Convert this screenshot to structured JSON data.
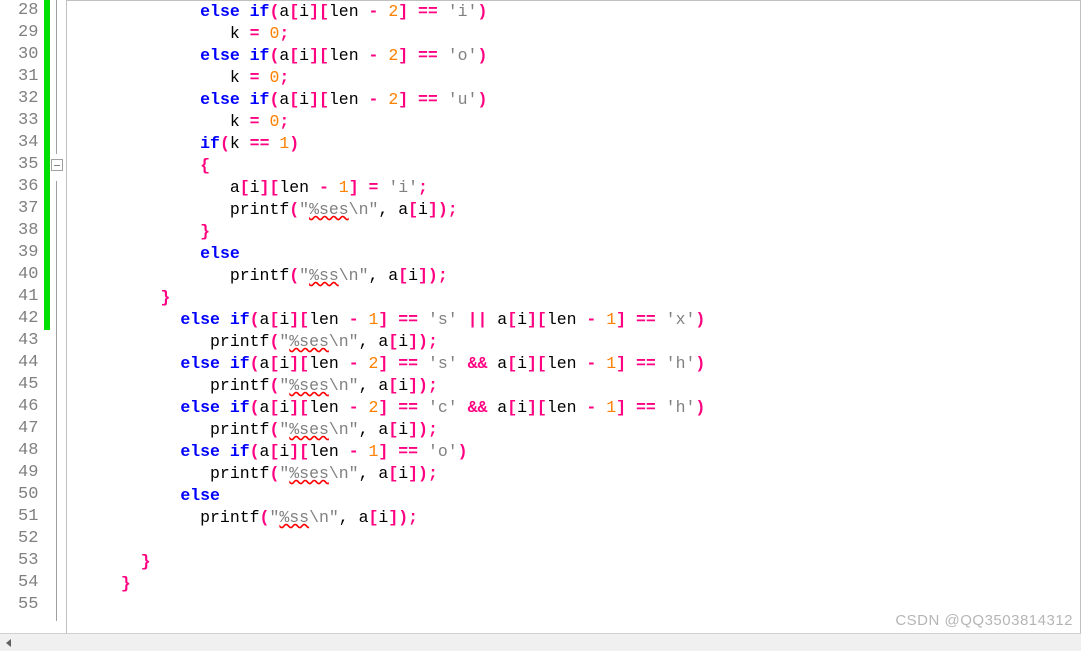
{
  "gutter": {
    "start": 28,
    "end": 55,
    "changed_through": 42
  },
  "fold": {
    "box_at": 35
  },
  "code_lines": [
    {
      "indent": 13,
      "tokens": [
        {
          "t": "else if",
          "c": "kw"
        },
        {
          "t": "(",
          "c": "paren"
        },
        {
          "t": "a"
        },
        {
          "t": "[",
          "c": "paren"
        },
        {
          "t": "i"
        },
        {
          "t": "][",
          "c": "paren"
        },
        {
          "t": "len "
        },
        {
          "t": "-",
          "c": "op"
        },
        {
          "t": " "
        },
        {
          "t": "2",
          "c": "num"
        },
        {
          "t": "]",
          "c": "paren"
        },
        {
          "t": " "
        },
        {
          "t": "==",
          "c": "op"
        },
        {
          "t": " "
        },
        {
          "t": "'i'",
          "c": "str"
        },
        {
          "t": ")",
          "c": "paren"
        }
      ]
    },
    {
      "indent": 16,
      "tokens": [
        {
          "t": "k "
        },
        {
          "t": "=",
          "c": "op"
        },
        {
          "t": " "
        },
        {
          "t": "0",
          "c": "num"
        },
        {
          "t": ";",
          "c": "op"
        }
      ]
    },
    {
      "indent": 13,
      "tokens": [
        {
          "t": "else if",
          "c": "kw"
        },
        {
          "t": "(",
          "c": "paren"
        },
        {
          "t": "a"
        },
        {
          "t": "[",
          "c": "paren"
        },
        {
          "t": "i"
        },
        {
          "t": "][",
          "c": "paren"
        },
        {
          "t": "len "
        },
        {
          "t": "-",
          "c": "op"
        },
        {
          "t": " "
        },
        {
          "t": "2",
          "c": "num"
        },
        {
          "t": "]",
          "c": "paren"
        },
        {
          "t": " "
        },
        {
          "t": "==",
          "c": "op"
        },
        {
          "t": " "
        },
        {
          "t": "'o'",
          "c": "str"
        },
        {
          "t": ")",
          "c": "paren"
        }
      ]
    },
    {
      "indent": 16,
      "tokens": [
        {
          "t": "k "
        },
        {
          "t": "=",
          "c": "op"
        },
        {
          "t": " "
        },
        {
          "t": "0",
          "c": "num"
        },
        {
          "t": ";",
          "c": "op"
        }
      ]
    },
    {
      "indent": 13,
      "tokens": [
        {
          "t": "else if",
          "c": "kw"
        },
        {
          "t": "(",
          "c": "paren"
        },
        {
          "t": "a"
        },
        {
          "t": "[",
          "c": "paren"
        },
        {
          "t": "i"
        },
        {
          "t": "][",
          "c": "paren"
        },
        {
          "t": "len "
        },
        {
          "t": "-",
          "c": "op"
        },
        {
          "t": " "
        },
        {
          "t": "2",
          "c": "num"
        },
        {
          "t": "]",
          "c": "paren"
        },
        {
          "t": " "
        },
        {
          "t": "==",
          "c": "op"
        },
        {
          "t": " "
        },
        {
          "t": "'u'",
          "c": "str"
        },
        {
          "t": ")",
          "c": "paren"
        }
      ]
    },
    {
      "indent": 16,
      "tokens": [
        {
          "t": "k "
        },
        {
          "t": "=",
          "c": "op"
        },
        {
          "t": " "
        },
        {
          "t": "0",
          "c": "num"
        },
        {
          "t": ";",
          "c": "op"
        }
      ]
    },
    {
      "indent": 13,
      "tokens": [
        {
          "t": "if",
          "c": "kw"
        },
        {
          "t": "(",
          "c": "paren"
        },
        {
          "t": "k "
        },
        {
          "t": "==",
          "c": "op"
        },
        {
          "t": " "
        },
        {
          "t": "1",
          "c": "num"
        },
        {
          "t": ")",
          "c": "paren"
        }
      ]
    },
    {
      "indent": 13,
      "tokens": [
        {
          "t": "{",
          "c": "op"
        }
      ]
    },
    {
      "indent": 16,
      "tokens": [
        {
          "t": "a"
        },
        {
          "t": "[",
          "c": "paren"
        },
        {
          "t": "i"
        },
        {
          "t": "][",
          "c": "paren"
        },
        {
          "t": "len "
        },
        {
          "t": "-",
          "c": "op"
        },
        {
          "t": " "
        },
        {
          "t": "1",
          "c": "num"
        },
        {
          "t": "]",
          "c": "paren"
        },
        {
          "t": " "
        },
        {
          "t": "=",
          "c": "op"
        },
        {
          "t": " "
        },
        {
          "t": "'i'",
          "c": "str"
        },
        {
          "t": ";",
          "c": "op"
        }
      ]
    },
    {
      "indent": 16,
      "tokens": [
        {
          "t": "printf"
        },
        {
          "t": "(",
          "c": "paren"
        },
        {
          "t": "\"",
          "c": "str"
        },
        {
          "t": "%ses",
          "c": "fmt"
        },
        {
          "t": "\\n\"",
          "c": "str"
        },
        {
          "t": ","
        },
        {
          "t": " a"
        },
        {
          "t": "[",
          "c": "paren"
        },
        {
          "t": "i"
        },
        {
          "t": "])",
          "c": "paren"
        },
        {
          "t": ";",
          "c": "op"
        }
      ]
    },
    {
      "indent": 13,
      "tokens": [
        {
          "t": "}",
          "c": "op"
        }
      ]
    },
    {
      "indent": 13,
      "tokens": [
        {
          "t": "else",
          "c": "kw"
        }
      ]
    },
    {
      "indent": 16,
      "tokens": [
        {
          "t": "printf"
        },
        {
          "t": "(",
          "c": "paren"
        },
        {
          "t": "\"",
          "c": "str"
        },
        {
          "t": "%ss",
          "c": "fmt"
        },
        {
          "t": "\\n\"",
          "c": "str"
        },
        {
          "t": ","
        },
        {
          "t": " a"
        },
        {
          "t": "[",
          "c": "paren"
        },
        {
          "t": "i"
        },
        {
          "t": "])",
          "c": "paren"
        },
        {
          "t": ";",
          "c": "op"
        }
      ]
    },
    {
      "indent": 9,
      "tokens": [
        {
          "t": "}",
          "c": "op"
        }
      ]
    },
    {
      "indent": 11,
      "tokens": [
        {
          "t": "else if",
          "c": "kw"
        },
        {
          "t": "(",
          "c": "paren"
        },
        {
          "t": "a"
        },
        {
          "t": "[",
          "c": "paren"
        },
        {
          "t": "i"
        },
        {
          "t": "][",
          "c": "paren"
        },
        {
          "t": "len "
        },
        {
          "t": "-",
          "c": "op"
        },
        {
          "t": " "
        },
        {
          "t": "1",
          "c": "num"
        },
        {
          "t": "]",
          "c": "paren"
        },
        {
          "t": " "
        },
        {
          "t": "==",
          "c": "op"
        },
        {
          "t": " "
        },
        {
          "t": "'s'",
          "c": "str"
        },
        {
          "t": " "
        },
        {
          "t": "||",
          "c": "op"
        },
        {
          "t": " a"
        },
        {
          "t": "[",
          "c": "paren"
        },
        {
          "t": "i"
        },
        {
          "t": "][",
          "c": "paren"
        },
        {
          "t": "len "
        },
        {
          "t": "-",
          "c": "op"
        },
        {
          "t": " "
        },
        {
          "t": "1",
          "c": "num"
        },
        {
          "t": "]",
          "c": "paren"
        },
        {
          "t": " "
        },
        {
          "t": "==",
          "c": "op"
        },
        {
          "t": " "
        },
        {
          "t": "'x'",
          "c": "str"
        },
        {
          "t": ")",
          "c": "paren"
        }
      ]
    },
    {
      "indent": 14,
      "tokens": [
        {
          "t": "printf"
        },
        {
          "t": "(",
          "c": "paren"
        },
        {
          "t": "\"",
          "c": "str"
        },
        {
          "t": "%ses",
          "c": "fmt"
        },
        {
          "t": "\\n\"",
          "c": "str"
        },
        {
          "t": ","
        },
        {
          "t": " a"
        },
        {
          "t": "[",
          "c": "paren"
        },
        {
          "t": "i"
        },
        {
          "t": "])",
          "c": "paren"
        },
        {
          "t": ";",
          "c": "op"
        }
      ]
    },
    {
      "indent": 11,
      "tokens": [
        {
          "t": "else if",
          "c": "kw"
        },
        {
          "t": "(",
          "c": "paren"
        },
        {
          "t": "a"
        },
        {
          "t": "[",
          "c": "paren"
        },
        {
          "t": "i"
        },
        {
          "t": "][",
          "c": "paren"
        },
        {
          "t": "len "
        },
        {
          "t": "-",
          "c": "op"
        },
        {
          "t": " "
        },
        {
          "t": "2",
          "c": "num"
        },
        {
          "t": "]",
          "c": "paren"
        },
        {
          "t": " "
        },
        {
          "t": "==",
          "c": "op"
        },
        {
          "t": " "
        },
        {
          "t": "'s'",
          "c": "str"
        },
        {
          "t": " "
        },
        {
          "t": "&&",
          "c": "op"
        },
        {
          "t": " a"
        },
        {
          "t": "[",
          "c": "paren"
        },
        {
          "t": "i"
        },
        {
          "t": "][",
          "c": "paren"
        },
        {
          "t": "len "
        },
        {
          "t": "-",
          "c": "op"
        },
        {
          "t": " "
        },
        {
          "t": "1",
          "c": "num"
        },
        {
          "t": "]",
          "c": "paren"
        },
        {
          "t": " "
        },
        {
          "t": "==",
          "c": "op"
        },
        {
          "t": " "
        },
        {
          "t": "'h'",
          "c": "str"
        },
        {
          "t": ")",
          "c": "paren"
        }
      ]
    },
    {
      "indent": 14,
      "tokens": [
        {
          "t": "printf"
        },
        {
          "t": "(",
          "c": "paren"
        },
        {
          "t": "\"",
          "c": "str"
        },
        {
          "t": "%ses",
          "c": "fmt"
        },
        {
          "t": "\\n\"",
          "c": "str"
        },
        {
          "t": ","
        },
        {
          "t": " a"
        },
        {
          "t": "[",
          "c": "paren"
        },
        {
          "t": "i"
        },
        {
          "t": "])",
          "c": "paren"
        },
        {
          "t": ";",
          "c": "op"
        }
      ]
    },
    {
      "indent": 11,
      "tokens": [
        {
          "t": "else if",
          "c": "kw"
        },
        {
          "t": "(",
          "c": "paren"
        },
        {
          "t": "a"
        },
        {
          "t": "[",
          "c": "paren"
        },
        {
          "t": "i"
        },
        {
          "t": "][",
          "c": "paren"
        },
        {
          "t": "len "
        },
        {
          "t": "-",
          "c": "op"
        },
        {
          "t": " "
        },
        {
          "t": "2",
          "c": "num"
        },
        {
          "t": "]",
          "c": "paren"
        },
        {
          "t": " "
        },
        {
          "t": "==",
          "c": "op"
        },
        {
          "t": " "
        },
        {
          "t": "'c'",
          "c": "str"
        },
        {
          "t": " "
        },
        {
          "t": "&&",
          "c": "op"
        },
        {
          "t": " a"
        },
        {
          "t": "[",
          "c": "paren"
        },
        {
          "t": "i"
        },
        {
          "t": "][",
          "c": "paren"
        },
        {
          "t": "len "
        },
        {
          "t": "-",
          "c": "op"
        },
        {
          "t": " "
        },
        {
          "t": "1",
          "c": "num"
        },
        {
          "t": "]",
          "c": "paren"
        },
        {
          "t": " "
        },
        {
          "t": "==",
          "c": "op"
        },
        {
          "t": " "
        },
        {
          "t": "'h'",
          "c": "str"
        },
        {
          "t": ")",
          "c": "paren"
        }
      ]
    },
    {
      "indent": 14,
      "tokens": [
        {
          "t": "printf"
        },
        {
          "t": "(",
          "c": "paren"
        },
        {
          "t": "\"",
          "c": "str"
        },
        {
          "t": "%ses",
          "c": "fmt"
        },
        {
          "t": "\\n\"",
          "c": "str"
        },
        {
          "t": ","
        },
        {
          "t": " a"
        },
        {
          "t": "[",
          "c": "paren"
        },
        {
          "t": "i"
        },
        {
          "t": "])",
          "c": "paren"
        },
        {
          "t": ";",
          "c": "op"
        }
      ]
    },
    {
      "indent": 11,
      "tokens": [
        {
          "t": "else if",
          "c": "kw"
        },
        {
          "t": "(",
          "c": "paren"
        },
        {
          "t": "a"
        },
        {
          "t": "[",
          "c": "paren"
        },
        {
          "t": "i"
        },
        {
          "t": "][",
          "c": "paren"
        },
        {
          "t": "len "
        },
        {
          "t": "-",
          "c": "op"
        },
        {
          "t": " "
        },
        {
          "t": "1",
          "c": "num"
        },
        {
          "t": "]",
          "c": "paren"
        },
        {
          "t": " "
        },
        {
          "t": "==",
          "c": "op"
        },
        {
          "t": " "
        },
        {
          "t": "'o'",
          "c": "str"
        },
        {
          "t": ")",
          "c": "paren"
        }
      ]
    },
    {
      "indent": 14,
      "tokens": [
        {
          "t": "printf"
        },
        {
          "t": "(",
          "c": "paren"
        },
        {
          "t": "\"",
          "c": "str"
        },
        {
          "t": "%ses",
          "c": "fmt"
        },
        {
          "t": "\\n\"",
          "c": "str"
        },
        {
          "t": ","
        },
        {
          "t": " a"
        },
        {
          "t": "[",
          "c": "paren"
        },
        {
          "t": "i"
        },
        {
          "t": "])",
          "c": "paren"
        },
        {
          "t": ";",
          "c": "op"
        }
      ]
    },
    {
      "indent": 11,
      "tokens": [
        {
          "t": "else",
          "c": "kw"
        }
      ]
    },
    {
      "indent": 13,
      "tokens": [
        {
          "t": "printf"
        },
        {
          "t": "(",
          "c": "paren"
        },
        {
          "t": "\"",
          "c": "str"
        },
        {
          "t": "%ss",
          "c": "fmt"
        },
        {
          "t": "\\n\"",
          "c": "str"
        },
        {
          "t": ","
        },
        {
          "t": " a"
        },
        {
          "t": "[",
          "c": "paren"
        },
        {
          "t": "i"
        },
        {
          "t": "])",
          "c": "paren"
        },
        {
          "t": ";",
          "c": "op"
        }
      ]
    },
    {
      "indent": 0,
      "tokens": []
    },
    {
      "indent": 7,
      "tokens": [
        {
          "t": "}",
          "c": "op"
        }
      ]
    },
    {
      "indent": 5,
      "tokens": [
        {
          "t": "}",
          "c": "op"
        }
      ]
    },
    {
      "indent": 0,
      "tokens": []
    }
  ],
  "watermark": "CSDN @QQ3503814312"
}
